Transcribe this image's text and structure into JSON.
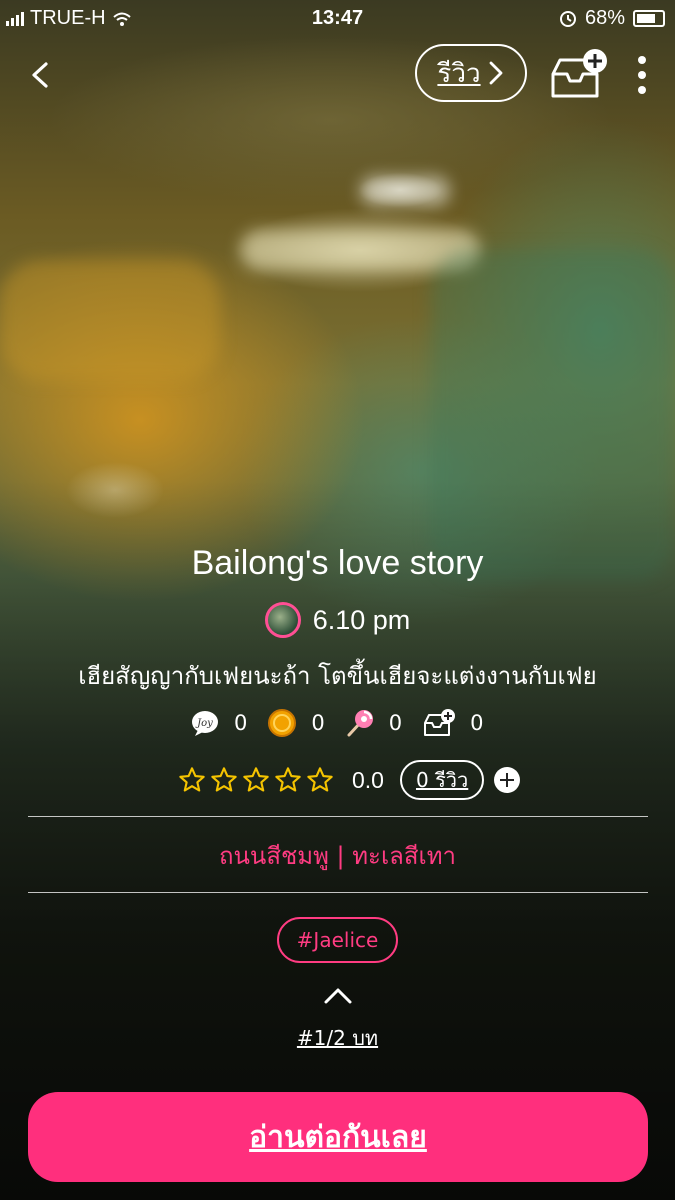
{
  "status_bar": {
    "carrier": "TRUE-H",
    "time": "13:47",
    "battery": "68%"
  },
  "header": {
    "review_label": "รีวิว"
  },
  "story": {
    "title": "Bailong's love story",
    "author": "6.10 pm",
    "tagline": "เฮียสัญญากับเฟยนะถ้า โตขึ้นเฮียจะแต่งงานกับเฟย",
    "stats": {
      "comments": "0",
      "coins": "0",
      "candy": "0",
      "shelf_adds": "0"
    },
    "rating": {
      "stars_filled": 0,
      "stars_total": 5,
      "score": "0.0",
      "review_count": "0 รีวิว"
    },
    "category": "ถนนสีชมพู | ทะเลสีเทา",
    "hashtag": "#Jaelice",
    "chapter": "#1/2 บท"
  },
  "actions": {
    "read_button": "อ่านต่อกันเลย"
  },
  "colors": {
    "accent_pink": "#ff2f7d",
    "star_gold": "#f5c400"
  },
  "icons": [
    "signal-icon",
    "wifi-icon",
    "alarm-icon",
    "battery-icon",
    "back-icon",
    "chevron-right-icon",
    "shelf-add-icon",
    "more-vertical-icon",
    "joy-comment-icon",
    "coin-icon",
    "candy-icon",
    "shelf-add-small-icon",
    "star-icon",
    "plus-icon",
    "chevron-up-icon"
  ]
}
